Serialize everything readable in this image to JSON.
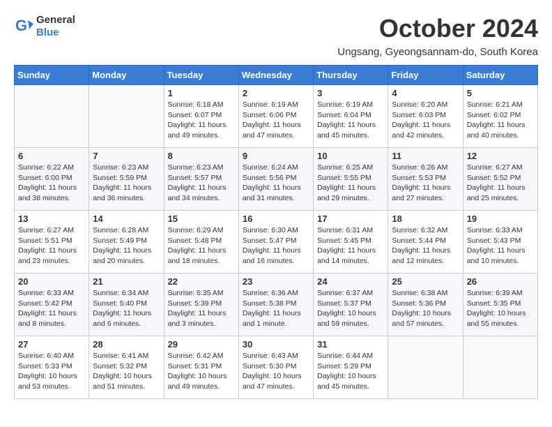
{
  "logo": {
    "general": "General",
    "blue": "Blue"
  },
  "calendar": {
    "month": "October 2024",
    "location": "Ungsang, Gyeongsannam-do, South Korea",
    "days_of_week": [
      "Sunday",
      "Monday",
      "Tuesday",
      "Wednesday",
      "Thursday",
      "Friday",
      "Saturday"
    ],
    "weeks": [
      [
        {
          "day": "",
          "info": ""
        },
        {
          "day": "",
          "info": ""
        },
        {
          "day": "1",
          "info": "Sunrise: 6:18 AM\nSunset: 6:07 PM\nDaylight: 11 hours and 49 minutes."
        },
        {
          "day": "2",
          "info": "Sunrise: 6:19 AM\nSunset: 6:06 PM\nDaylight: 11 hours and 47 minutes."
        },
        {
          "day": "3",
          "info": "Sunrise: 6:19 AM\nSunset: 6:04 PM\nDaylight: 11 hours and 45 minutes."
        },
        {
          "day": "4",
          "info": "Sunrise: 6:20 AM\nSunset: 6:03 PM\nDaylight: 11 hours and 42 minutes."
        },
        {
          "day": "5",
          "info": "Sunrise: 6:21 AM\nSunset: 6:02 PM\nDaylight: 11 hours and 40 minutes."
        }
      ],
      [
        {
          "day": "6",
          "info": "Sunrise: 6:22 AM\nSunset: 6:00 PM\nDaylight: 11 hours and 38 minutes."
        },
        {
          "day": "7",
          "info": "Sunrise: 6:23 AM\nSunset: 5:59 PM\nDaylight: 11 hours and 36 minutes."
        },
        {
          "day": "8",
          "info": "Sunrise: 6:23 AM\nSunset: 5:57 PM\nDaylight: 11 hours and 34 minutes."
        },
        {
          "day": "9",
          "info": "Sunrise: 6:24 AM\nSunset: 5:56 PM\nDaylight: 11 hours and 31 minutes."
        },
        {
          "day": "10",
          "info": "Sunrise: 6:25 AM\nSunset: 5:55 PM\nDaylight: 11 hours and 29 minutes."
        },
        {
          "day": "11",
          "info": "Sunrise: 6:26 AM\nSunset: 5:53 PM\nDaylight: 11 hours and 27 minutes."
        },
        {
          "day": "12",
          "info": "Sunrise: 6:27 AM\nSunset: 5:52 PM\nDaylight: 11 hours and 25 minutes."
        }
      ],
      [
        {
          "day": "13",
          "info": "Sunrise: 6:27 AM\nSunset: 5:51 PM\nDaylight: 11 hours and 23 minutes."
        },
        {
          "day": "14",
          "info": "Sunrise: 6:28 AM\nSunset: 5:49 PM\nDaylight: 11 hours and 20 minutes."
        },
        {
          "day": "15",
          "info": "Sunrise: 6:29 AM\nSunset: 5:48 PM\nDaylight: 11 hours and 18 minutes."
        },
        {
          "day": "16",
          "info": "Sunrise: 6:30 AM\nSunset: 5:47 PM\nDaylight: 11 hours and 16 minutes."
        },
        {
          "day": "17",
          "info": "Sunrise: 6:31 AM\nSunset: 5:45 PM\nDaylight: 11 hours and 14 minutes."
        },
        {
          "day": "18",
          "info": "Sunrise: 6:32 AM\nSunset: 5:44 PM\nDaylight: 11 hours and 12 minutes."
        },
        {
          "day": "19",
          "info": "Sunrise: 6:33 AM\nSunset: 5:43 PM\nDaylight: 11 hours and 10 minutes."
        }
      ],
      [
        {
          "day": "20",
          "info": "Sunrise: 6:33 AM\nSunset: 5:42 PM\nDaylight: 11 hours and 8 minutes."
        },
        {
          "day": "21",
          "info": "Sunrise: 6:34 AM\nSunset: 5:40 PM\nDaylight: 11 hours and 6 minutes."
        },
        {
          "day": "22",
          "info": "Sunrise: 6:35 AM\nSunset: 5:39 PM\nDaylight: 11 hours and 3 minutes."
        },
        {
          "day": "23",
          "info": "Sunrise: 6:36 AM\nSunset: 5:38 PM\nDaylight: 11 hours and 1 minute."
        },
        {
          "day": "24",
          "info": "Sunrise: 6:37 AM\nSunset: 5:37 PM\nDaylight: 10 hours and 59 minutes."
        },
        {
          "day": "25",
          "info": "Sunrise: 6:38 AM\nSunset: 5:36 PM\nDaylight: 10 hours and 57 minutes."
        },
        {
          "day": "26",
          "info": "Sunrise: 6:39 AM\nSunset: 5:35 PM\nDaylight: 10 hours and 55 minutes."
        }
      ],
      [
        {
          "day": "27",
          "info": "Sunrise: 6:40 AM\nSunset: 5:33 PM\nDaylight: 10 hours and 53 minutes."
        },
        {
          "day": "28",
          "info": "Sunrise: 6:41 AM\nSunset: 5:32 PM\nDaylight: 10 hours and 51 minutes."
        },
        {
          "day": "29",
          "info": "Sunrise: 6:42 AM\nSunset: 5:31 PM\nDaylight: 10 hours and 49 minutes."
        },
        {
          "day": "30",
          "info": "Sunrise: 6:43 AM\nSunset: 5:30 PM\nDaylight: 10 hours and 47 minutes."
        },
        {
          "day": "31",
          "info": "Sunrise: 6:44 AM\nSunset: 5:29 PM\nDaylight: 10 hours and 45 minutes."
        },
        {
          "day": "",
          "info": ""
        },
        {
          "day": "",
          "info": ""
        }
      ]
    ]
  }
}
